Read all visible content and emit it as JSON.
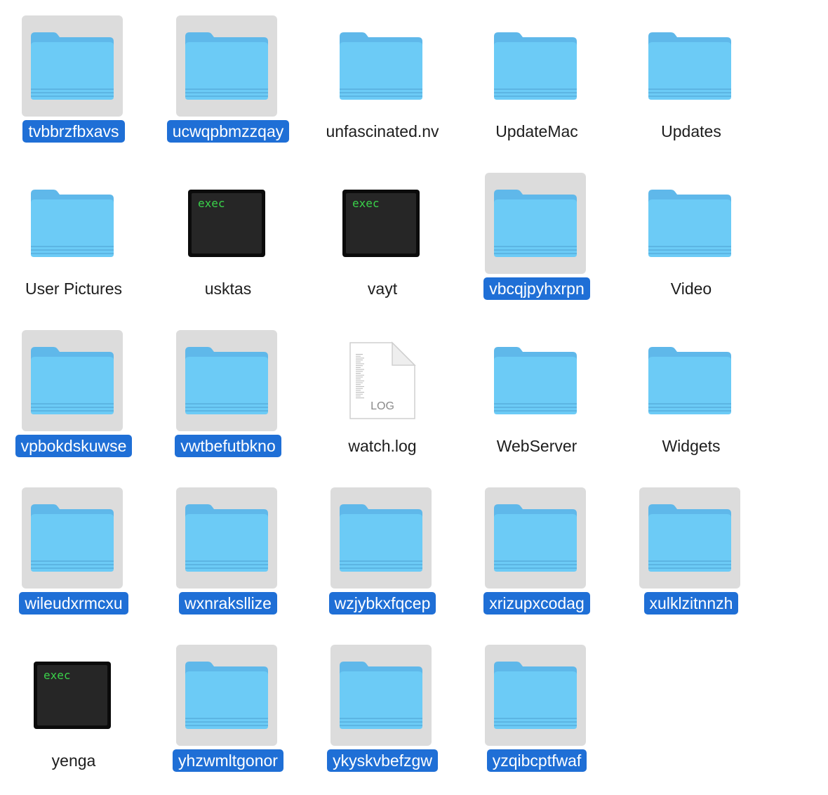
{
  "items": [
    {
      "name": "tvbbrzfbxavs",
      "kind": "folder",
      "icon": "folder-icon",
      "selected": true
    },
    {
      "name": "ucwqpbmzzqay",
      "kind": "folder",
      "icon": "folder-icon",
      "selected": true
    },
    {
      "name": "unfascinated.nv",
      "kind": "folder",
      "icon": "folder-icon",
      "selected": false
    },
    {
      "name": "UpdateMac",
      "kind": "folder",
      "icon": "folder-icon",
      "selected": false
    },
    {
      "name": "Updates",
      "kind": "folder",
      "icon": "folder-icon",
      "selected": false
    },
    {
      "name": "User Pictures",
      "kind": "folder",
      "icon": "folder-icon",
      "selected": false
    },
    {
      "name": "usktas",
      "kind": "exec",
      "icon": "terminal-exec-icon",
      "selected": false,
      "badge": "exec"
    },
    {
      "name": "vayt",
      "kind": "exec",
      "icon": "terminal-exec-icon",
      "selected": false,
      "badge": "exec"
    },
    {
      "name": "vbcqjpyhxrpn",
      "kind": "folder",
      "icon": "folder-icon",
      "selected": true
    },
    {
      "name": "Video",
      "kind": "folder",
      "icon": "folder-icon",
      "selected": false
    },
    {
      "name": "vpbokdskuwse",
      "kind": "folder",
      "icon": "folder-icon",
      "selected": true
    },
    {
      "name": "vwtbefutbkno",
      "kind": "folder",
      "icon": "folder-icon",
      "selected": true
    },
    {
      "name": "watch.log",
      "kind": "log",
      "icon": "log-document-icon",
      "selected": false,
      "badge": "LOG"
    },
    {
      "name": "WebServer",
      "kind": "folder",
      "icon": "folder-icon",
      "selected": false
    },
    {
      "name": "Widgets",
      "kind": "folder",
      "icon": "folder-icon",
      "selected": false
    },
    {
      "name": "wileudxrmcxu",
      "kind": "folder",
      "icon": "folder-icon",
      "selected": true
    },
    {
      "name": "wxnraksllize",
      "kind": "folder",
      "icon": "folder-icon",
      "selected": true
    },
    {
      "name": "wzjybkxfqcep",
      "kind": "folder",
      "icon": "folder-icon",
      "selected": true
    },
    {
      "name": "xrizupxcodag",
      "kind": "folder",
      "icon": "folder-icon",
      "selected": true
    },
    {
      "name": "xulklzitnnzh",
      "kind": "folder",
      "icon": "folder-icon",
      "selected": true
    },
    {
      "name": "yenga",
      "kind": "exec",
      "icon": "terminal-exec-icon",
      "selected": false,
      "badge": "exec"
    },
    {
      "name": "yhzwmltgonor",
      "kind": "folder",
      "icon": "folder-icon",
      "selected": true
    },
    {
      "name": "ykyskvbefzgw",
      "kind": "folder",
      "icon": "folder-icon",
      "selected": true
    },
    {
      "name": "yzqibcptfwaf",
      "kind": "folder",
      "icon": "folder-icon",
      "selected": true
    }
  ],
  "colors": {
    "selection_background": "#1f6fd6",
    "icon_highlight": "#dcdcdc",
    "folder_blue": "#6ccbf6",
    "terminal_green": "#3ad24a"
  }
}
